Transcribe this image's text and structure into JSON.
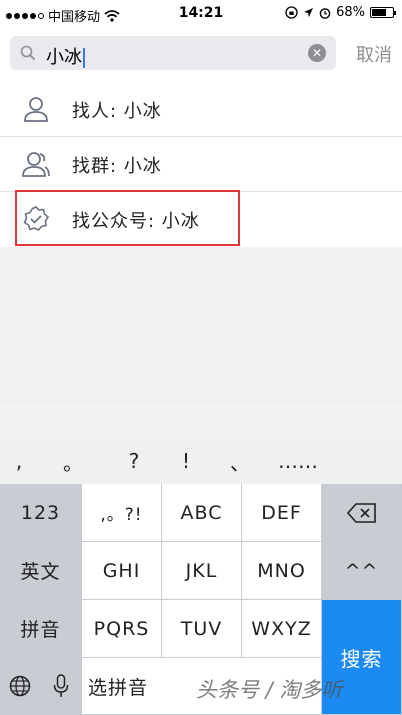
{
  "status_bar": {
    "carrier": "中国移动",
    "time": "14:21",
    "battery": "68%",
    "battery_level": 0.68
  },
  "search": {
    "query": "小冰",
    "cancel_label": "取消"
  },
  "results": [
    {
      "label": "找人: 小冰",
      "icon": "person-icon"
    },
    {
      "label": "找群: 小冰",
      "icon": "group-icon"
    },
    {
      "label": "找公众号: 小冰",
      "icon": "official-account-badge-icon"
    }
  ],
  "keyboard": {
    "punctuation": [
      ",",
      "。",
      "?",
      "!",
      "、",
      "……"
    ],
    "rows": [
      [
        "123",
        ",。?!",
        "ABC",
        "DEF",
        "⌫"
      ],
      [
        "英文",
        "GHI",
        "JKL",
        "MNO",
        "^^"
      ],
      [
        "拼音",
        "PQRS",
        "TUV",
        "WXYZ"
      ],
      [
        "🌐",
        "🎤",
        "选拼音"
      ]
    ],
    "search_label": "搜索"
  },
  "watermark": "头条号 / 淘多听"
}
